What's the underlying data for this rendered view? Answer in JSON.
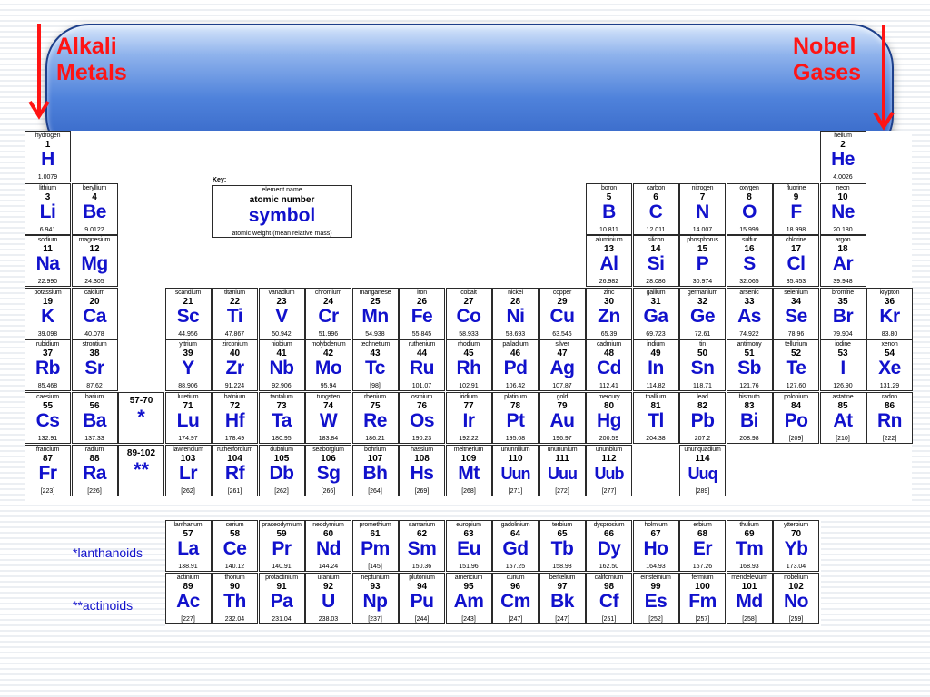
{
  "annotations": {
    "left": [
      "Alkali",
      "Metals"
    ],
    "right": [
      "Nobel",
      "Gases"
    ],
    "arrow_color": "#ff1414"
  },
  "key": {
    "title": "Key:",
    "line1": "element name",
    "line2": "atomic number",
    "line3": "symbol",
    "line4": "atomic weight (mean relative mass)"
  },
  "markers": [
    {
      "id": "lanthanoid-marker",
      "number": "57-70",
      "symbol": "*"
    },
    {
      "id": "actinoid-marker",
      "number": "89-102",
      "symbol": "**"
    }
  ],
  "series_labels": {
    "lanthanoids": "*lanthanoids",
    "actinoids": "**actinoids"
  },
  "main_elements": [
    {
      "n": "hydrogen",
      "z": "1",
      "s": "H",
      "w": "1.0079",
      "r": 1,
      "c": 1
    },
    {
      "n": "helium",
      "z": "2",
      "s": "He",
      "w": "4.0026",
      "r": 1,
      "c": 18
    },
    {
      "n": "lithium",
      "z": "3",
      "s": "Li",
      "w": "6.941",
      "r": 2,
      "c": 1
    },
    {
      "n": "beryllium",
      "z": "4",
      "s": "Be",
      "w": "9.0122",
      "r": 2,
      "c": 2
    },
    {
      "n": "boron",
      "z": "5",
      "s": "B",
      "w": "10.811",
      "r": 2,
      "c": 13
    },
    {
      "n": "carbon",
      "z": "6",
      "s": "C",
      "w": "12.011",
      "r": 2,
      "c": 14
    },
    {
      "n": "nitrogen",
      "z": "7",
      "s": "N",
      "w": "14.007",
      "r": 2,
      "c": 15
    },
    {
      "n": "oxygen",
      "z": "8",
      "s": "O",
      "w": "15.999",
      "r": 2,
      "c": 16
    },
    {
      "n": "fluorine",
      "z": "9",
      "s": "F",
      "w": "18.998",
      "r": 2,
      "c": 17
    },
    {
      "n": "neon",
      "z": "10",
      "s": "Ne",
      "w": "20.180",
      "r": 2,
      "c": 18
    },
    {
      "n": "sodium",
      "z": "11",
      "s": "Na",
      "w": "22.990",
      "r": 3,
      "c": 1
    },
    {
      "n": "magnesium",
      "z": "12",
      "s": "Mg",
      "w": "24.305",
      "r": 3,
      "c": 2
    },
    {
      "n": "aluminium",
      "z": "13",
      "s": "Al",
      "w": "26.982",
      "r": 3,
      "c": 13
    },
    {
      "n": "silicon",
      "z": "14",
      "s": "Si",
      "w": "28.086",
      "r": 3,
      "c": 14
    },
    {
      "n": "phosphorus",
      "z": "15",
      "s": "P",
      "w": "30.974",
      "r": 3,
      "c": 15
    },
    {
      "n": "sulfur",
      "z": "16",
      "s": "S",
      "w": "32.065",
      "r": 3,
      "c": 16
    },
    {
      "n": "chlorine",
      "z": "17",
      "s": "Cl",
      "w": "35.453",
      "r": 3,
      "c": 17
    },
    {
      "n": "argon",
      "z": "18",
      "s": "Ar",
      "w": "39.948",
      "r": 3,
      "c": 18
    },
    {
      "n": "potassium",
      "z": "19",
      "s": "K",
      "w": "39.098",
      "r": 4,
      "c": 1
    },
    {
      "n": "calcium",
      "z": "20",
      "s": "Ca",
      "w": "40.078",
      "r": 4,
      "c": 2
    },
    {
      "n": "scandium",
      "z": "21",
      "s": "Sc",
      "w": "44.956",
      "r": 4,
      "c": 4
    },
    {
      "n": "titanium",
      "z": "22",
      "s": "Ti",
      "w": "47.867",
      "r": 4,
      "c": 5
    },
    {
      "n": "vanadium",
      "z": "23",
      "s": "V",
      "w": "50.942",
      "r": 4,
      "c": 6
    },
    {
      "n": "chromium",
      "z": "24",
      "s": "Cr",
      "w": "51.996",
      "r": 4,
      "c": 7
    },
    {
      "n": "manganese",
      "z": "25",
      "s": "Mn",
      "w": "54.938",
      "r": 4,
      "c": 8
    },
    {
      "n": "iron",
      "z": "26",
      "s": "Fe",
      "w": "55.845",
      "r": 4,
      "c": 9
    },
    {
      "n": "cobalt",
      "z": "27",
      "s": "Co",
      "w": "58.933",
      "r": 4,
      "c": 10
    },
    {
      "n": "nickel",
      "z": "28",
      "s": "Ni",
      "w": "58.693",
      "r": 4,
      "c": 11
    },
    {
      "n": "copper",
      "z": "29",
      "s": "Cu",
      "w": "63.546",
      "r": 4,
      "c": 12
    },
    {
      "n": "zinc",
      "z": "30",
      "s": "Zn",
      "w": "65.39",
      "r": 4,
      "c": 13
    },
    {
      "n": "gallium",
      "z": "31",
      "s": "Ga",
      "w": "69.723",
      "r": 4,
      "c": 14
    },
    {
      "n": "germanium",
      "z": "32",
      "s": "Ge",
      "w": "72.61",
      "r": 4,
      "c": 15
    },
    {
      "n": "arsenic",
      "z": "33",
      "s": "As",
      "w": "74.922",
      "r": 4,
      "c": 16
    },
    {
      "n": "selenium",
      "z": "34",
      "s": "Se",
      "w": "78.96",
      "r": 4,
      "c": 17
    },
    {
      "n": "bromine",
      "z": "35",
      "s": "Br",
      "w": "79.904",
      "r": 4,
      "c": 18
    },
    {
      "n": "krypton",
      "z": "36",
      "s": "Kr",
      "w": "83.80",
      "r": 4,
      "c": 19
    },
    {
      "n": "rubidium",
      "z": "37",
      "s": "Rb",
      "w": "85.468",
      "r": 5,
      "c": 1
    },
    {
      "n": "strontium",
      "z": "38",
      "s": "Sr",
      "w": "87.62",
      "r": 5,
      "c": 2
    },
    {
      "n": "yttrium",
      "z": "39",
      "s": "Y",
      "w": "88.906",
      "r": 5,
      "c": 4
    },
    {
      "n": "zirconium",
      "z": "40",
      "s": "Zr",
      "w": "91.224",
      "r": 5,
      "c": 5
    },
    {
      "n": "niobium",
      "z": "41",
      "s": "Nb",
      "w": "92.906",
      "r": 5,
      "c": 6
    },
    {
      "n": "molybdenum",
      "z": "42",
      "s": "Mo",
      "w": "95.94",
      "r": 5,
      "c": 7
    },
    {
      "n": "technetium",
      "z": "43",
      "s": "Tc",
      "w": "[98]",
      "r": 5,
      "c": 8
    },
    {
      "n": "ruthenium",
      "z": "44",
      "s": "Ru",
      "w": "101.07",
      "r": 5,
      "c": 9
    },
    {
      "n": "rhodium",
      "z": "45",
      "s": "Rh",
      "w": "102.91",
      "r": 5,
      "c": 10
    },
    {
      "n": "palladium",
      "z": "46",
      "s": "Pd",
      "w": "106.42",
      "r": 5,
      "c": 11
    },
    {
      "n": "silver",
      "z": "47",
      "s": "Ag",
      "w": "107.87",
      "r": 5,
      "c": 12
    },
    {
      "n": "cadmium",
      "z": "48",
      "s": "Cd",
      "w": "112.41",
      "r": 5,
      "c": 13
    },
    {
      "n": "indium",
      "z": "49",
      "s": "In",
      "w": "114.82",
      "r": 5,
      "c": 14
    },
    {
      "n": "tin",
      "z": "50",
      "s": "Sn",
      "w": "118.71",
      "r": 5,
      "c": 15
    },
    {
      "n": "antimony",
      "z": "51",
      "s": "Sb",
      "w": "121.76",
      "r": 5,
      "c": 16
    },
    {
      "n": "tellurium",
      "z": "52",
      "s": "Te",
      "w": "127.60",
      "r": 5,
      "c": 17
    },
    {
      "n": "iodine",
      "z": "53",
      "s": "I",
      "w": "126.90",
      "r": 5,
      "c": 18
    },
    {
      "n": "xenon",
      "z": "54",
      "s": "Xe",
      "w": "131.29",
      "r": 5,
      "c": 19
    },
    {
      "n": "caesium",
      "z": "55",
      "s": "Cs",
      "w": "132.91",
      "r": 6,
      "c": 1
    },
    {
      "n": "barium",
      "z": "56",
      "s": "Ba",
      "w": "137.33",
      "r": 6,
      "c": 2
    },
    {
      "n": "lutetium",
      "z": "71",
      "s": "Lu",
      "w": "174.97",
      "r": 6,
      "c": 4
    },
    {
      "n": "hafnium",
      "z": "72",
      "s": "Hf",
      "w": "178.49",
      "r": 6,
      "c": 5
    },
    {
      "n": "tantalum",
      "z": "73",
      "s": "Ta",
      "w": "180.95",
      "r": 6,
      "c": 6
    },
    {
      "n": "tungsten",
      "z": "74",
      "s": "W",
      "w": "183.84",
      "r": 6,
      "c": 7
    },
    {
      "n": "rhenium",
      "z": "75",
      "s": "Re",
      "w": "186.21",
      "r": 6,
      "c": 8
    },
    {
      "n": "osmium",
      "z": "76",
      "s": "Os",
      "w": "190.23",
      "r": 6,
      "c": 9
    },
    {
      "n": "iridium",
      "z": "77",
      "s": "Ir",
      "w": "192.22",
      "r": 6,
      "c": 10
    },
    {
      "n": "platinum",
      "z": "78",
      "s": "Pt",
      "w": "195.08",
      "r": 6,
      "c": 11
    },
    {
      "n": "gold",
      "z": "79",
      "s": "Au",
      "w": "196.97",
      "r": 6,
      "c": 12
    },
    {
      "n": "mercury",
      "z": "80",
      "s": "Hg",
      "w": "200.59",
      "r": 6,
      "c": 13
    },
    {
      "n": "thallium",
      "z": "81",
      "s": "Tl",
      "w": "204.38",
      "r": 6,
      "c": 14
    },
    {
      "n": "lead",
      "z": "82",
      "s": "Pb",
      "w": "207.2",
      "r": 6,
      "c": 15
    },
    {
      "n": "bismuth",
      "z": "83",
      "s": "Bi",
      "w": "208.98",
      "r": 6,
      "c": 16
    },
    {
      "n": "polonium",
      "z": "84",
      "s": "Po",
      "w": "[209]",
      "r": 6,
      "c": 17
    },
    {
      "n": "astatine",
      "z": "85",
      "s": "At",
      "w": "[210]",
      "r": 6,
      "c": 18
    },
    {
      "n": "radon",
      "z": "86",
      "s": "Rn",
      "w": "[222]",
      "r": 6,
      "c": 19
    },
    {
      "n": "francium",
      "z": "87",
      "s": "Fr",
      "w": "[223]",
      "r": 7,
      "c": 1
    },
    {
      "n": "radium",
      "z": "88",
      "s": "Ra",
      "w": "[226]",
      "r": 7,
      "c": 2
    },
    {
      "n": "lawrencium",
      "z": "103",
      "s": "Lr",
      "w": "[262]",
      "r": 7,
      "c": 4
    },
    {
      "n": "rutherfordium",
      "z": "104",
      "s": "Rf",
      "w": "[261]",
      "r": 7,
      "c": 5
    },
    {
      "n": "dubnium",
      "z": "105",
      "s": "Db",
      "w": "[262]",
      "r": 7,
      "c": 6
    },
    {
      "n": "seaborgium",
      "z": "106",
      "s": "Sg",
      "w": "[266]",
      "r": 7,
      "c": 7
    },
    {
      "n": "bohrium",
      "z": "107",
      "s": "Bh",
      "w": "[264]",
      "r": 7,
      "c": 8
    },
    {
      "n": "hassium",
      "z": "108",
      "s": "Hs",
      "w": "[269]",
      "r": 7,
      "c": 9
    },
    {
      "n": "meitnerium",
      "z": "109",
      "s": "Mt",
      "w": "[268]",
      "r": 7,
      "c": 10
    },
    {
      "n": "ununnilium",
      "z": "110",
      "s": "Uun",
      "w": "[271]",
      "r": 7,
      "c": 11
    },
    {
      "n": "unununium",
      "z": "111",
      "s": "Uuu",
      "w": "[272]",
      "r": 7,
      "c": 12
    },
    {
      "n": "ununbium",
      "z": "112",
      "s": "Uub",
      "w": "[277]",
      "r": 7,
      "c": 13
    },
    {
      "n": "ununquadium",
      "z": "114",
      "s": "Uuq",
      "w": "[289]",
      "r": 7,
      "c": 15
    }
  ],
  "lanthanoids": [
    {
      "n": "lanthanum",
      "z": "57",
      "s": "La",
      "w": "138.91"
    },
    {
      "n": "cerium",
      "z": "58",
      "s": "Ce",
      "w": "140.12"
    },
    {
      "n": "praseodymium",
      "z": "59",
      "s": "Pr",
      "w": "140.91"
    },
    {
      "n": "neodymium",
      "z": "60",
      "s": "Nd",
      "w": "144.24"
    },
    {
      "n": "promethium",
      "z": "61",
      "s": "Pm",
      "w": "[145]"
    },
    {
      "n": "samarium",
      "z": "62",
      "s": "Sm",
      "w": "150.36"
    },
    {
      "n": "europium",
      "z": "63",
      "s": "Eu",
      "w": "151.96"
    },
    {
      "n": "gadolinium",
      "z": "64",
      "s": "Gd",
      "w": "157.25"
    },
    {
      "n": "terbium",
      "z": "65",
      "s": "Tb",
      "w": "158.93"
    },
    {
      "n": "dysprosium",
      "z": "66",
      "s": "Dy",
      "w": "162.50"
    },
    {
      "n": "holmium",
      "z": "67",
      "s": "Ho",
      "w": "164.93"
    },
    {
      "n": "erbium",
      "z": "68",
      "s": "Er",
      "w": "167.26"
    },
    {
      "n": "thulium",
      "z": "69",
      "s": "Tm",
      "w": "168.93"
    },
    {
      "n": "ytterbium",
      "z": "70",
      "s": "Yb",
      "w": "173.04"
    }
  ],
  "actinoids": [
    {
      "n": "actinium",
      "z": "89",
      "s": "Ac",
      "w": "[227]"
    },
    {
      "n": "thorium",
      "z": "90",
      "s": "Th",
      "w": "232.04"
    },
    {
      "n": "protactinium",
      "z": "91",
      "s": "Pa",
      "w": "231.04"
    },
    {
      "n": "uranium",
      "z": "92",
      "s": "U",
      "w": "238.03"
    },
    {
      "n": "neptunium",
      "z": "93",
      "s": "Np",
      "w": "[237]"
    },
    {
      "n": "plutonium",
      "z": "94",
      "s": "Pu",
      "w": "[244]"
    },
    {
      "n": "americium",
      "z": "95",
      "s": "Am",
      "w": "[243]"
    },
    {
      "n": "curium",
      "z": "96",
      "s": "Cm",
      "w": "[247]"
    },
    {
      "n": "berkelium",
      "z": "97",
      "s": "Bk",
      "w": "[247]"
    },
    {
      "n": "californium",
      "z": "98",
      "s": "Cf",
      "w": "[251]"
    },
    {
      "n": "einsteinium",
      "z": "99",
      "s": "Es",
      "w": "[252]"
    },
    {
      "n": "fermium",
      "z": "100",
      "s": "Fm",
      "w": "[257]"
    },
    {
      "n": "mendelevium",
      "z": "101",
      "s": "Md",
      "w": "[258]"
    },
    {
      "n": "nobelium",
      "z": "102",
      "s": "No",
      "w": "[259]"
    }
  ]
}
